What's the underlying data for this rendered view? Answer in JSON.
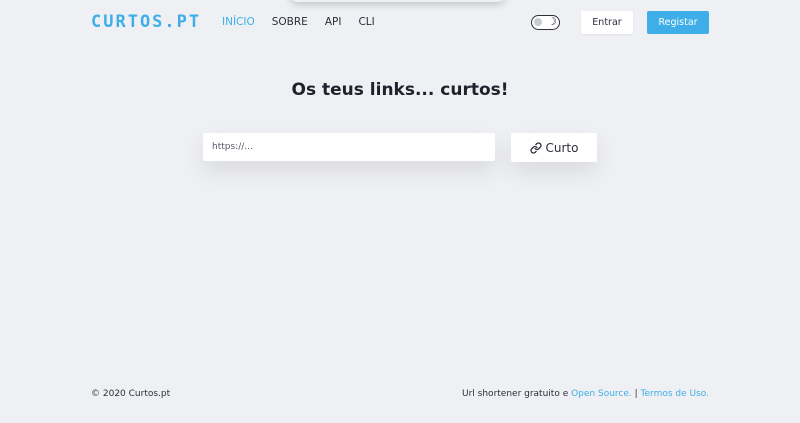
{
  "header": {
    "logo": "CURTOS.PT",
    "nav": [
      {
        "label": "INÍCIO"
      },
      {
        "label": "SOBRE"
      },
      {
        "label": "API"
      },
      {
        "label": "CLI"
      }
    ],
    "login_label": "Entrar",
    "register_label": "Registar"
  },
  "main": {
    "title": "Os teus links... curtos!",
    "url_placeholder": "https://...",
    "submit_label": "Curto"
  },
  "footer": {
    "copyright": "© 2020 Curtos.pt",
    "tagline": "Url shortener gratuito e ",
    "open_source_label": "Open Source.",
    "separator": " | ",
    "terms_label": "Termos de Uso."
  },
  "colors": {
    "accent": "#3daee8",
    "background": "#eff0f4",
    "text": "#2c2f3a"
  },
  "icons": {
    "theme_toggle": "moon-icon",
    "submit": "link-icon"
  }
}
